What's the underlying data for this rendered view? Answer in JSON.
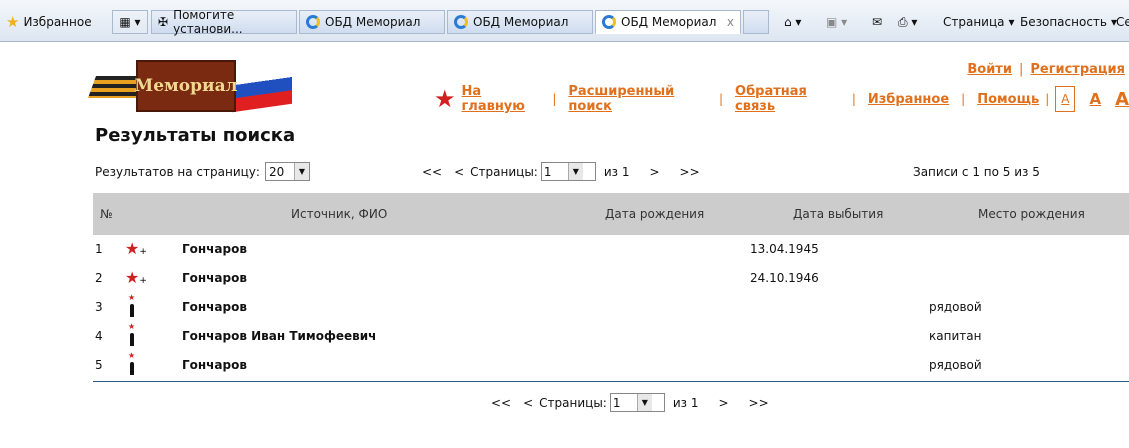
{
  "browser": {
    "favorites": "Избранное",
    "tabs": [
      "Помогите установи...",
      "ОБД Мемориал",
      "ОБД Мемориал",
      "ОБД Мемориал"
    ],
    "tab_close": "x",
    "commands": [
      "Страница",
      "Безопасность",
      "Се"
    ]
  },
  "logo": {
    "text": "Мемориал"
  },
  "auth": {
    "login": "Войти",
    "sep": "|",
    "register": "Регистрация"
  },
  "nav": {
    "items": [
      "На главную",
      "Расширенный поиск",
      "Обратная связь",
      "Избранное",
      "Помощь"
    ],
    "font_sizes": [
      "A",
      "A",
      "A"
    ]
  },
  "page": {
    "title": "Результаты поиска"
  },
  "controls": {
    "per_page_label": "Результатов на страницу:",
    "per_page_value": "20",
    "first": "<<",
    "prev": "<",
    "pages_label": "Страницы:",
    "page_value": "1",
    "of": "из 1",
    "next": ">",
    "last": ">>",
    "records": "Записи с 1 по 5 из 5"
  },
  "table": {
    "headers": [
      "№",
      "Источник, ФИО",
      "Дата рождения",
      "Дата выбытия",
      "Место рождения"
    ],
    "rows": [
      {
        "n": "1",
        "icon": "star",
        "name": "Гончаров",
        "death": "13.04.1945",
        "extra": ""
      },
      {
        "n": "2",
        "icon": "star",
        "name": "Гончаров",
        "death": "24.10.1946",
        "extra": ""
      },
      {
        "n": "3",
        "icon": "soldier",
        "name": "Гончаров",
        "death": "",
        "extra": "рядовой"
      },
      {
        "n": "4",
        "icon": "soldier",
        "name": "Гончаров Иван Тимофеевич",
        "death": "",
        "extra": "капитан"
      },
      {
        "n": "5",
        "icon": "soldier",
        "name": "Гончаров",
        "death": "",
        "extra": "рядовой"
      }
    ]
  },
  "colors": {
    "accent": "#e0701c",
    "header_bg": "#cccccc"
  }
}
